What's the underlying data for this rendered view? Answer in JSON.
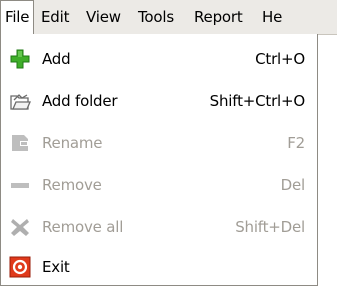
{
  "menubar": {
    "items": [
      {
        "label": "File"
      },
      {
        "label": "Edit"
      },
      {
        "label": "View"
      },
      {
        "label": "Tools"
      },
      {
        "label": "Report"
      },
      {
        "label": "He"
      }
    ]
  },
  "file_menu": {
    "items": [
      {
        "label": "Add",
        "shortcut": "Ctrl+O",
        "icon": "add-plus-icon",
        "enabled": true
      },
      {
        "label": "Add folder",
        "shortcut": "Shift+Ctrl+O",
        "icon": "add-folder-icon",
        "enabled": true
      },
      {
        "label": "Rename",
        "shortcut": "F2",
        "icon": "rename-icon",
        "enabled": false
      },
      {
        "label": "Remove",
        "shortcut": "Del",
        "icon": "remove-minus-icon",
        "enabled": false
      },
      {
        "label": "Remove all",
        "shortcut": "Shift+Del",
        "icon": "remove-all-x-icon",
        "enabled": false
      },
      {
        "label": "Exit",
        "shortcut": "",
        "icon": "exit-power-icon",
        "enabled": true
      }
    ]
  },
  "colors": {
    "menubar_bg": "#eceae6",
    "add_icon_green": "#3fae2a",
    "exit_icon_red": "#e03a1c",
    "disabled_text": "#a19d96"
  }
}
